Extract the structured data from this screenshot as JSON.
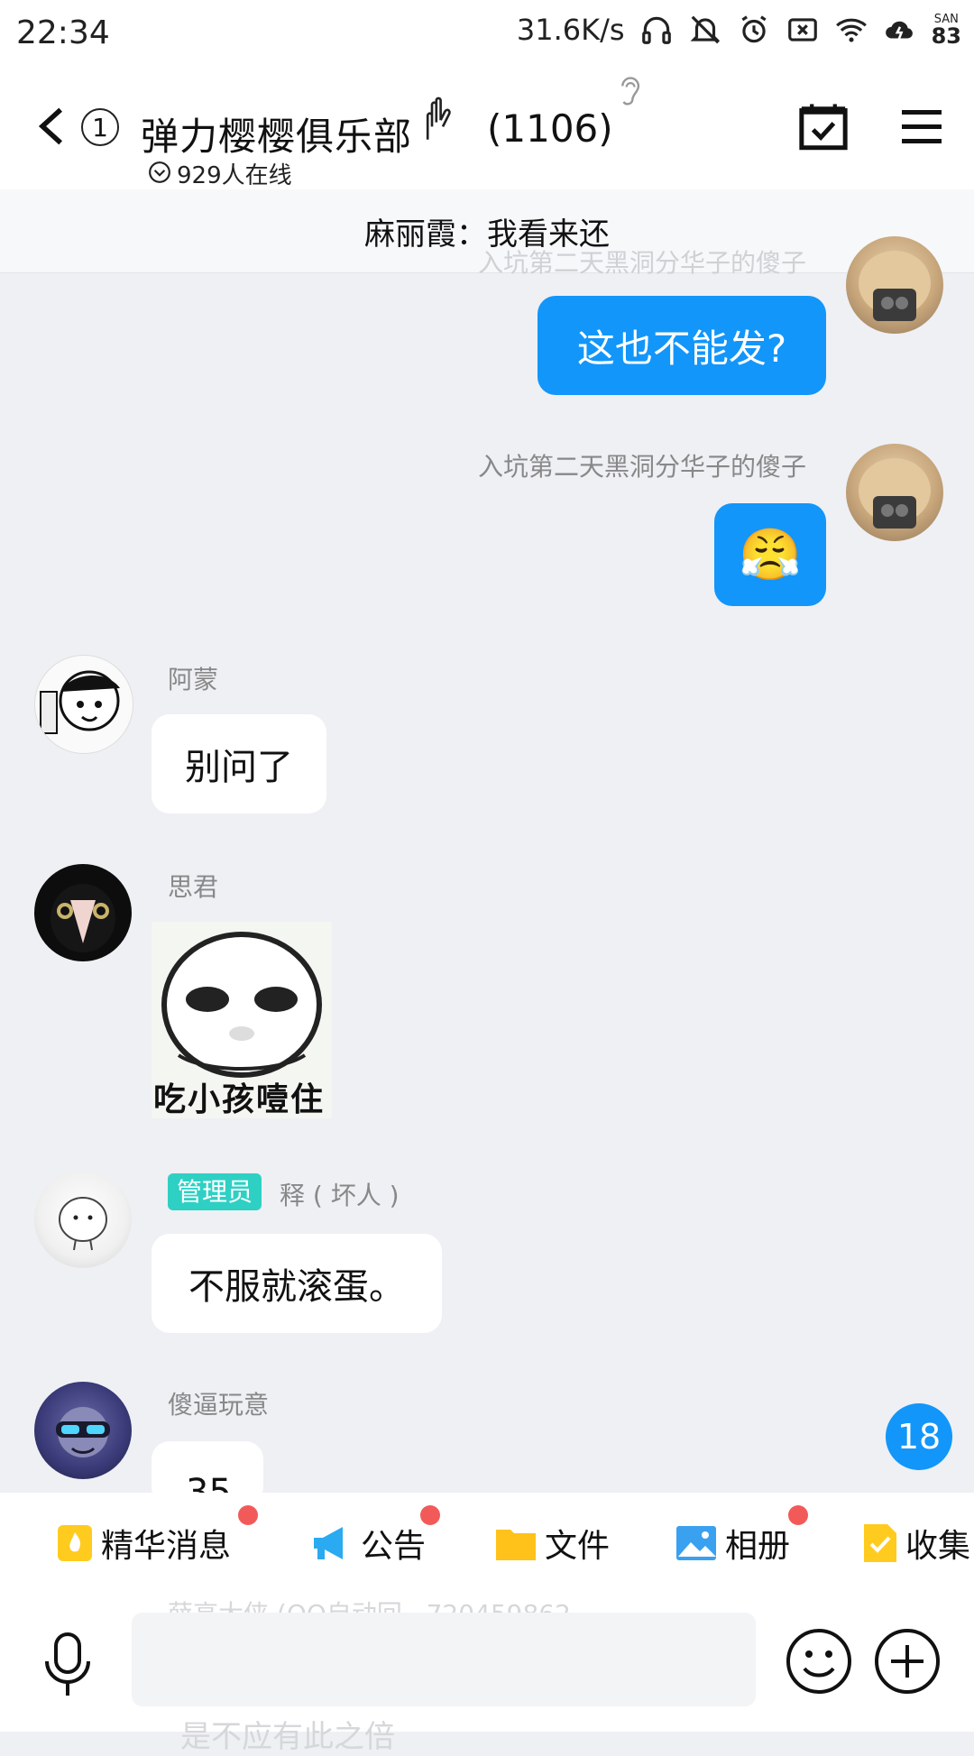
{
  "status_bar": {
    "time": "22:34",
    "speed": "31.6K/s",
    "battery_label_top": "SAN",
    "battery_value": "83"
  },
  "header": {
    "unread_indicator": "1",
    "group_name": "弹力樱樱俱乐部",
    "member_count": "(1106)",
    "online": "929人在线"
  },
  "pinned": {
    "text": "麻丽霞：我看来还"
  },
  "messages": {
    "faded_sender_top": "入坑第二天黑洞分华子的傻子",
    "m1_text": "这也不能发?",
    "m2_sender": "入坑第二天黑洞分华子的傻子",
    "m2_emoji": "😤",
    "m3_sender": "阿蒙",
    "m3_text": "别问了",
    "m4_sender": "思君",
    "m4_sticker_caption": "吃小孩噎住",
    "m5_badge": "管理员",
    "m5_sender": "释 ( 坏人 )",
    "m5_text": "不服就滚蛋。",
    "m6_sender": "傻逼玩意",
    "m6_text": "35",
    "faded_sender_bottom": "薛高大侠 (QQ自动回...720459862",
    "faded_text_bottom": "是不应有此之倍"
  },
  "unread_count": "18",
  "toolbar": {
    "items": [
      {
        "label": "精华消息"
      },
      {
        "label": "公告"
      },
      {
        "label": "文件"
      },
      {
        "label": "相册"
      },
      {
        "label": "收集"
      }
    ]
  },
  "colors": {
    "accent_blue": "#1296fa",
    "admin_badge": "#2fd0c4",
    "red_dot": "#f25a5a"
  }
}
